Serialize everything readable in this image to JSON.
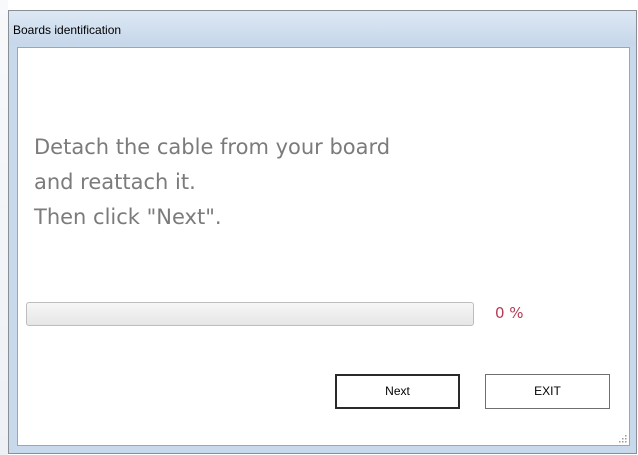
{
  "window": {
    "title": "Boards identification"
  },
  "message": {
    "lines": [
      "Detach the cable from your board",
      "and reattach it.",
      "Then click \"Next\"."
    ]
  },
  "progress": {
    "value_percent": 0,
    "label": "0 %"
  },
  "buttons": {
    "next_label": "Next",
    "exit_label": "EXIT"
  },
  "colors": {
    "message_text": "#7b7b7b",
    "progress_label": "#b43c55",
    "title_bar": "#c8d9ec"
  },
  "icons": {
    "resize_grip": "resize-grip-icon"
  }
}
